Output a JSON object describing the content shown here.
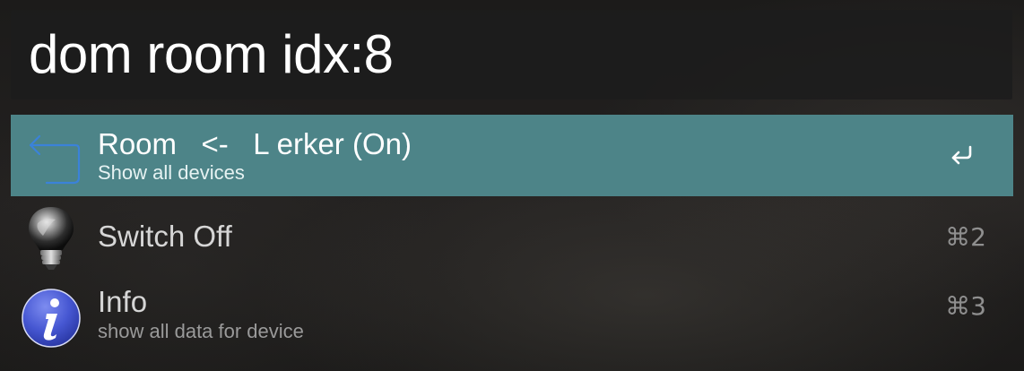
{
  "search": {
    "query": "dom room idx:8"
  },
  "results": [
    {
      "title": "Room   <-   L erker (On)",
      "subtitle": "Show all devices",
      "icon": "return-arrow-icon",
      "shortcut_icon": "return-key-icon",
      "selected": true
    },
    {
      "title": "Switch Off",
      "subtitle": "",
      "icon": "lightbulb-icon",
      "shortcut": "⌘2",
      "selected": false
    },
    {
      "title": "Info",
      "subtitle": "show all data for device",
      "icon": "info-icon",
      "shortcut": "⌘3",
      "selected": false
    }
  ],
  "colors": {
    "selected_row": "#4d8488",
    "search_bg": "#1c1c1c",
    "info_icon": "#4b5fd6",
    "return_arrow_icon": "#3b82d9"
  }
}
